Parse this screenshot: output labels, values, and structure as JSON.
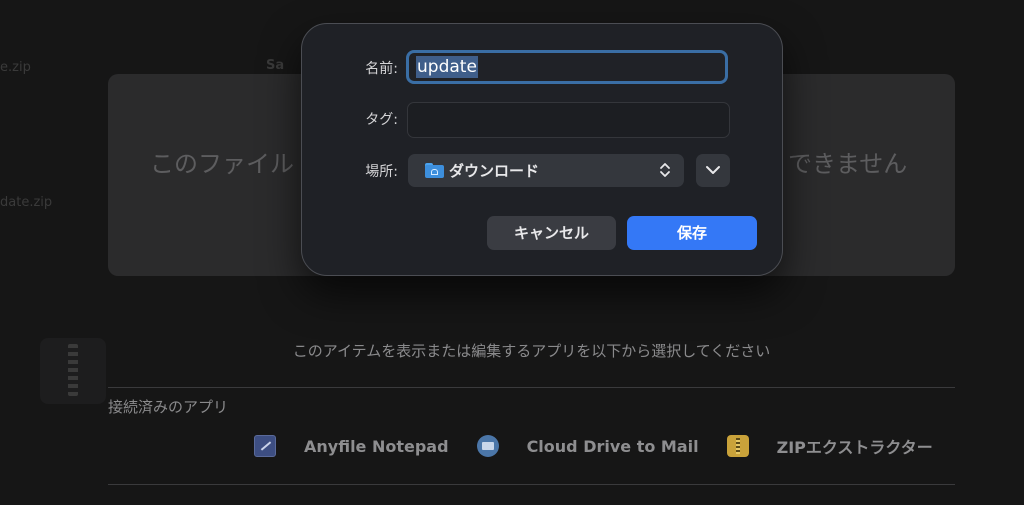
{
  "background": {
    "top_fragment_left": "e.zip",
    "top_fragment_right": "Sa",
    "left_fragment": "date.zip",
    "panel_message_left": "このファイル",
    "panel_message_right": "できません",
    "prompt": "このアイテムを表示または編集するアプリを以下から選択してください",
    "connected_apps_title": "接続済みのアプリ",
    "apps": [
      {
        "name": "Anyfile Notepad",
        "icon": "notepad-icon"
      },
      {
        "name": "Cloud Drive to Mail",
        "icon": "mail-icon"
      },
      {
        "name": "ZIPエクストラクター",
        "icon": "zip-extractor-icon"
      }
    ]
  },
  "dialog": {
    "name_label": "名前:",
    "name_value": "update",
    "tag_label": "タグ:",
    "tag_value": "",
    "location_label": "場所:",
    "location_value": "ダウンロード",
    "cancel_label": "キャンセル",
    "save_label": "保存"
  },
  "colors": {
    "accent": "#3478f6",
    "focus_ring": "#3a6ea5",
    "folder": "#3d8fdd"
  }
}
